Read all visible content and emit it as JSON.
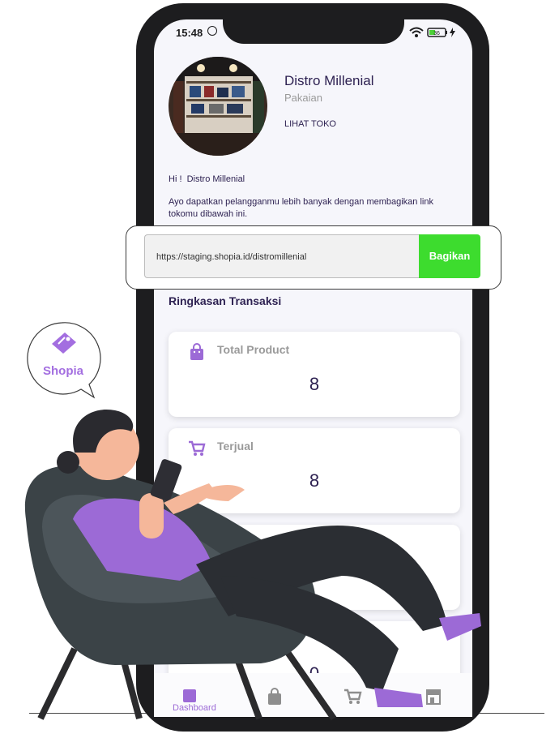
{
  "status": {
    "time": "15:48",
    "battery": "36"
  },
  "store": {
    "name": "Distro Millenial",
    "category": "Pakaian",
    "view_store_label": "LIHAT TOKO"
  },
  "greeting": "Hi !  Distro Millenial",
  "invite_text": "Ayo dapatkan pelangganmu lebih banyak dengan membagikan link tokomu dibawah ini.",
  "share": {
    "url": "https://staging.shopia.id/distromillenial",
    "button_label": "Bagikan"
  },
  "summary": {
    "title": "Ringkasan Transaksi",
    "cards": [
      {
        "label": "Total Product",
        "value": "8",
        "icon": "shopping-bag-icon"
      },
      {
        "label": "Terjual",
        "value": "8",
        "icon": "cart-icon"
      },
      {
        "label": "",
        "value": "",
        "icon": ""
      },
      {
        "label": "",
        "value": "0",
        "icon": ""
      }
    ]
  },
  "nav": {
    "items": [
      {
        "label": "Dashboard",
        "icon": "dashboard-icon"
      },
      {
        "label": "",
        "icon": "shopping-bag-icon"
      },
      {
        "label": "",
        "icon": "cart-icon"
      },
      {
        "label": "",
        "icon": "store-icon"
      }
    ]
  },
  "brand": {
    "name": "Shopia",
    "color": "#a36ee0"
  },
  "colors": {
    "accent_green": "#3ddc2e",
    "text_dark": "#2e2252",
    "icon_purple": "#9c6ad6"
  }
}
